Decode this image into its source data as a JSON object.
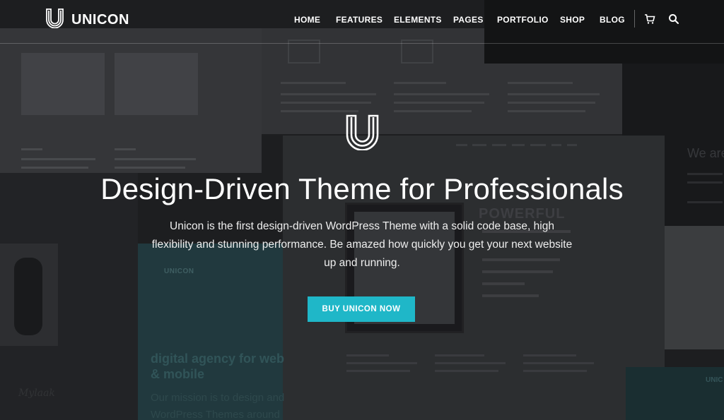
{
  "brand": {
    "name": "UNICON"
  },
  "nav": {
    "items": [
      {
        "id": "home",
        "label": "HOME"
      },
      {
        "id": "features",
        "label": "FEATURES"
      },
      {
        "id": "elements",
        "label": "ELEMENTS"
      },
      {
        "id": "pages",
        "label": "PAGES"
      },
      {
        "id": "portfolio",
        "label": "PORTFOLIO"
      },
      {
        "id": "shop",
        "label": "SHOP"
      },
      {
        "id": "blog",
        "label": "BLOG"
      }
    ],
    "icons": [
      "cart-icon",
      "search-icon"
    ]
  },
  "hero": {
    "title": "Design-Driven Theme for Professionals",
    "description": "Unicon is the first design-driven WordPress Theme with a solid code base, high flexibility and stunning performance. Be amazed how quickly you get your next website up and running.",
    "cta_label": "BUY UNICON NOW"
  },
  "background": {
    "powerful": "POWERFUL",
    "we_are": "We are",
    "digital_agency": "digital agency for web & mobile",
    "mission": "Our mission is to design and WordPress Themes around",
    "signature": "Mylaak",
    "unicon_small": "UNICON",
    "unicon_small_2": "UNIC"
  },
  "colors": {
    "accent": "#1fb7c8",
    "background": "#242628",
    "text": "#ffffff"
  }
}
